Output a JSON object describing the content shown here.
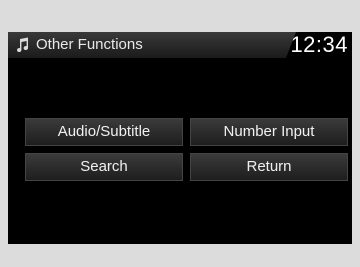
{
  "header": {
    "icon": "music-note-icon",
    "title": "Other Functions",
    "clock": "12:34"
  },
  "buttons": {
    "audio_subtitle": "Audio/Subtitle",
    "number_input": "Number Input",
    "search": "Search",
    "return": "Return"
  },
  "colors": {
    "background": "#dcdcdc",
    "screen": "#000000",
    "button": "#2c2c2c",
    "text": "#f0f0f0"
  }
}
